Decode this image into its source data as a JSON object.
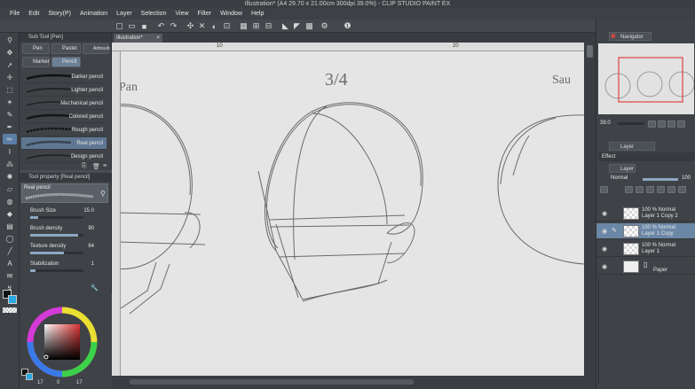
{
  "window": {
    "title": "Illustration* (A4 29.70 x 21.00cm 300dpi 39.0%) - CLIP STUDIO PAINT EX"
  },
  "menu": [
    "File",
    "Edit",
    "Story(P)",
    "Animation",
    "Layer",
    "Selection",
    "View",
    "Filter",
    "Window",
    "Help"
  ],
  "sub_tool": {
    "header": "Sub Tool [Pen]",
    "tabs": [
      "Pen",
      "Pastel",
      "Marker",
      "Pencil"
    ],
    "extra_tab": "Airbrush",
    "brushes": [
      "Darker pencil",
      "Lighter pencil",
      "Mechanical pencil",
      "Colored pencil",
      "Rough pencil",
      "Real pencil",
      "Design pencil"
    ]
  },
  "tool_property": {
    "header": "Tool property [Real pencil]",
    "preset": "Real pencil",
    "props": [
      {
        "label": "Brush Size",
        "value": "15.0",
        "fill": 0.15
      },
      {
        "label": "Brush density",
        "value": "90",
        "fill": 0.9
      },
      {
        "label": "Texture density",
        "value": "64",
        "fill": 0.64
      },
      {
        "label": "Stabilization",
        "value": "1",
        "fill": 0.1
      }
    ]
  },
  "color": {
    "bottom_values": [
      "17",
      "0",
      "17"
    ]
  },
  "document": {
    "tab": "Illustration*",
    "ruler_marks": [
      "10",
      "20"
    ],
    "sketch_labels": {
      "center": "3/4",
      "left": "Pan",
      "right": "Sau"
    }
  },
  "navigator": {
    "tab": "Navigator",
    "zoom": "39.0"
  },
  "layer_property": {
    "tab": "Layer Property",
    "effect_label": "Effect"
  },
  "layers_panel": {
    "tab": "Layer",
    "blend_mode": "Normal",
    "opacity": "100",
    "layers": [
      {
        "line1": "100 % Normal",
        "line2": "Layer 1 Copy 2",
        "selected": false
      },
      {
        "line1": "100 % Normal",
        "line2": "Layer 1 Copy",
        "selected": true
      },
      {
        "line1": "100 % Normal",
        "line2": "Layer 1",
        "selected": false
      },
      {
        "line1": "",
        "line2": "Paper",
        "selected": false
      }
    ]
  },
  "colors": {
    "accent": "#5b7ea6",
    "canvas": "#e5e5e5",
    "panel": "#3f4347"
  }
}
